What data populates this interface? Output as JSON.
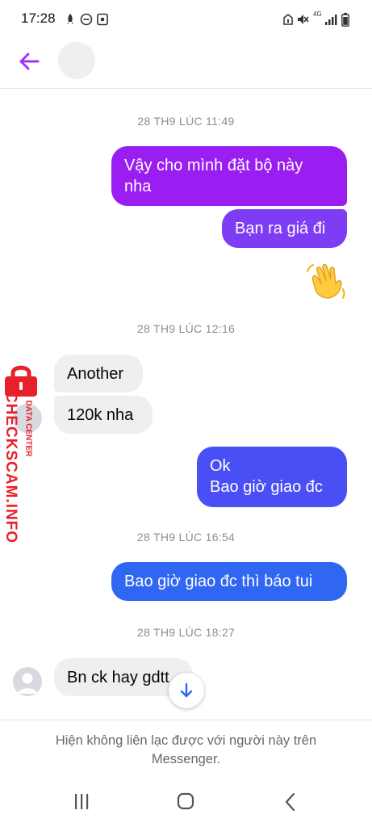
{
  "status_bar": {
    "time": "17:28",
    "left_icons": [
      "rocket-icon",
      "do-not-disturb-icon",
      "screenshot-icon"
    ],
    "right_icons": [
      "alarm-icon",
      "vibrate-mute-icon",
      "4g-signal-icon",
      "signal-bars-icon",
      "battery-icon"
    ],
    "network_label": "4G"
  },
  "header": {
    "back_icon": "arrow-left-icon",
    "accent_color": "#a033ff"
  },
  "messages": {
    "ts1": "28 TH9 LÚC 11:49",
    "out1": "Vậy cho mình đặt bộ này\nnha",
    "out2": "Bạn ra giá đi",
    "wave_emoji": "waving-hand-icon",
    "ts2": "28 TH9 LÚC 12:16",
    "in1": "Another",
    "in2": "120k nha",
    "out3": "Ok\nBao giờ giao đc",
    "ts3": "28 TH9 LÚC 16:54",
    "out4": "Bao giờ giao đc thì báo tui",
    "ts4": "28 TH9 LÚC 18:27",
    "in3": "Bn ck hay gdtt"
  },
  "colors": {
    "bubble_purple": "#9a1df2",
    "bubble_violet": "#7e3cf4",
    "bubble_indigo": "#4a4ff5",
    "bubble_blue": "#2f66f2",
    "incoming_bg": "#efefef",
    "timestamp": "#8a8d91",
    "watermark_red": "#e8202a"
  },
  "watermark": {
    "main": "CHECKSCAM.INFO",
    "sub": "DATA CENTER"
  },
  "footer": {
    "notice": "Hiện không liên lạc được với người này trên Messenger."
  },
  "nav": {
    "icons": [
      "recent-apps-icon",
      "home-icon",
      "back-icon"
    ]
  }
}
